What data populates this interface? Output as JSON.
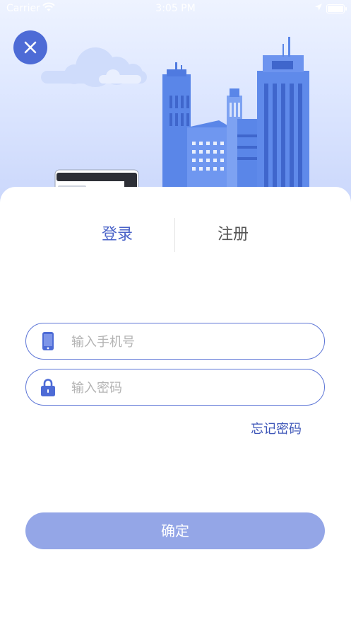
{
  "status_bar": {
    "carrier": "Carrier",
    "time": "3:05 PM"
  },
  "header": {
    "close_icon": "close-icon"
  },
  "tabs": {
    "login": "登录",
    "register": "注册",
    "active": "login"
  },
  "form": {
    "phone": {
      "placeholder": "输入手机号",
      "value": "",
      "icon": "phone-icon"
    },
    "password": {
      "placeholder": "输入密码",
      "value": "",
      "icon": "lock-icon"
    },
    "forgot_label": "忘记密码"
  },
  "confirm_label": "确定",
  "colors": {
    "accent": "#4a63c8",
    "border": "#5c75d6",
    "button": "#94a6e7",
    "close": "#4d6bd6"
  }
}
